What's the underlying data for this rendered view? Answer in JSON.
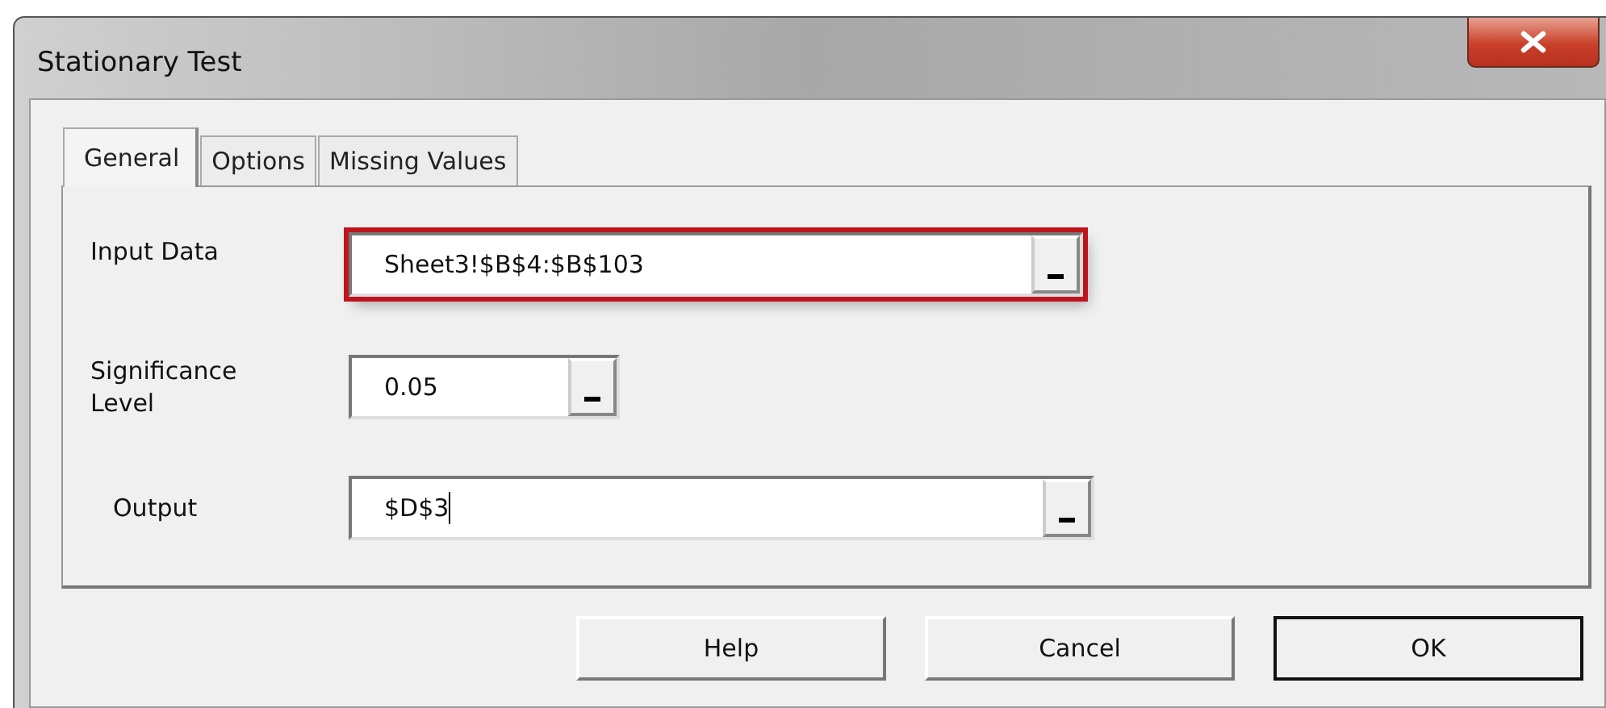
{
  "window": {
    "title": "Stationary Test"
  },
  "tabs": [
    {
      "label": "General",
      "selected": true
    },
    {
      "label": "Options",
      "selected": false
    },
    {
      "label": "Missing Values",
      "selected": false
    }
  ],
  "fields": [
    {
      "label": "Input Data",
      "value": "Sheet3!$B$4:$B$103",
      "highlighted": true,
      "focused": false,
      "kind": "range"
    },
    {
      "label": "Significance\nLevel",
      "value": "0.05",
      "highlighted": false,
      "focused": false,
      "kind": "number"
    },
    {
      "label": "Output",
      "value": "$D$3",
      "highlighted": false,
      "focused": true,
      "kind": "range"
    }
  ],
  "buttons": [
    {
      "label": "Help",
      "default": false
    },
    {
      "label": "Cancel",
      "default": false
    },
    {
      "label": "OK",
      "default": true
    }
  ]
}
